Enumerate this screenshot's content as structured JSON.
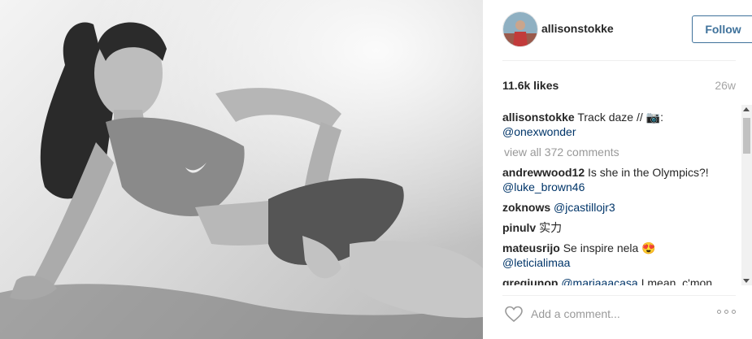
{
  "post": {
    "photo_alt": "Black and white photo of an athlete reclining on a running track",
    "username": "allisonstokke",
    "follow_label": "Follow",
    "likes": "11.6k likes",
    "age": "26w",
    "caption": {
      "username": "allisonstokke",
      "text": "Track daze // 📷:",
      "mention": "@onexwonder"
    },
    "view_all_comments": "view all 372 comments",
    "comments": [
      {
        "username": "andrewwood12",
        "text": "Is she in the Olympics?!",
        "mention": "@luke_brown46"
      },
      {
        "username": "zoknows",
        "text": "",
        "mention": "@jcastillojr3"
      },
      {
        "username": "pinulv",
        "text": "实力",
        "mention": ""
      },
      {
        "username": "mateusrijo",
        "text": "Se inspire nela 😍",
        "mention": "@leticialimaa"
      },
      {
        "username": "gregjunop",
        "text": "I mean, c'mon",
        "mention": "@mariaaacasa"
      }
    ],
    "add_comment_placeholder": "Add a comment...",
    "icons": {
      "like": "heart-icon",
      "more": "more-options-icon"
    }
  },
  "colors": {
    "link": "#003569",
    "follow": "#3f729b",
    "muted": "#999999"
  }
}
